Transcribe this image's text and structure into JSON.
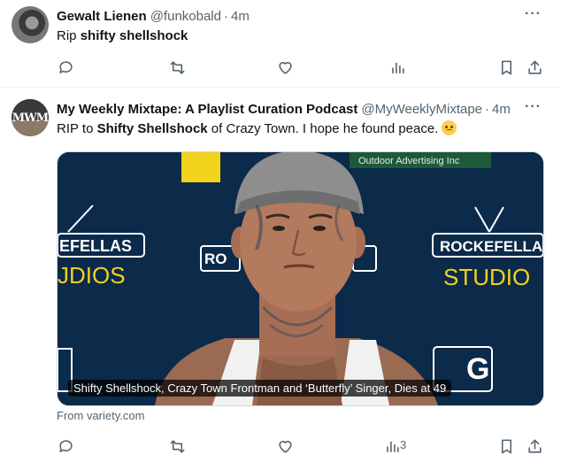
{
  "tweets": [
    {
      "display_name": "Gewalt Lienen",
      "handle": "@funkobald",
      "separator": "·",
      "time": "4m",
      "more": "···",
      "text_prefix": "Rip ",
      "text_bold": "shifty shellshock",
      "text_suffix": ""
    },
    {
      "display_name": "My Weekly Mixtape: A Playlist Curation Podcast",
      "handle": "@MyWeeklyMixtape",
      "separator": "·",
      "time": "4m",
      "more": "···",
      "text_prefix": "RIP to ",
      "text_bold": "Shifty Shellshock",
      "text_suffix": " of Crazy Town. I hope he found peace.",
      "emoji": "disappointed-face",
      "avatar_text": "MWM",
      "media": {
        "caption": "Shifty Shellshock, Crazy Town Frontman and ‘Butterfly’ Singer, Dies at 49",
        "source": "From variety.com",
        "backdrop_left_top": "EFELLAS",
        "backdrop_left_bottom": "JDIOS",
        "backdrop_right_top": "ROCKEFELLA",
        "backdrop_right_bottom": "STUDIO",
        "backdrop_banner": "Outdoor Advertising Inc",
        "backdrop_mid": "RO",
        "backdrop_bottom_right": "G"
      },
      "reply_count": "",
      "views_count": "3"
    }
  ],
  "icons": [
    "reply-icon",
    "retweet-icon",
    "like-icon",
    "views-icon",
    "bookmark-icon",
    "share-icon",
    "more-icon"
  ],
  "colors": {
    "text": "#0f1419",
    "muted": "#536471",
    "divider": "#eff3f4",
    "backdrop": "#0c2a4a",
    "studio_yellow": "#f2d21b"
  }
}
